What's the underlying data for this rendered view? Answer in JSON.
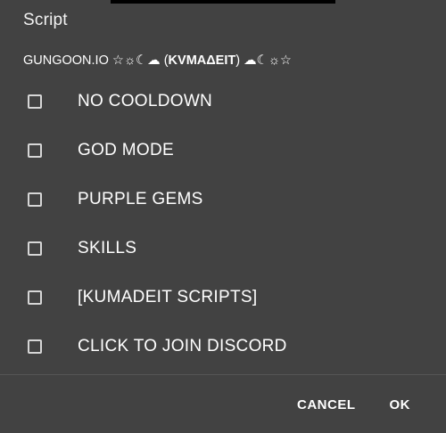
{
  "dialog": {
    "title": "Script",
    "subtitle_prefix": "GUNGOON.IO ☆☼☾☁ (",
    "subtitle_bold": "KVMAΔEIT",
    "subtitle_suffix": ") ☁☾☼☆"
  },
  "options": [
    {
      "label": "NO COOLDOWN",
      "checked": false
    },
    {
      "label": "GOD MODE",
      "checked": false
    },
    {
      "label": "PURPLE GEMS",
      "checked": false
    },
    {
      "label": "SKILLS",
      "checked": false
    },
    {
      "label": "[KUMADEIT SCRIPTS]",
      "checked": false
    },
    {
      "label": "CLICK TO JOIN DISCORD",
      "checked": false
    }
  ],
  "actions": {
    "cancel_label": "CANCEL",
    "ok_label": "OK"
  },
  "colors": {
    "dialog_bg": "#424242",
    "text": "#ffffff",
    "checkbox_border": "#d6d6d6"
  }
}
